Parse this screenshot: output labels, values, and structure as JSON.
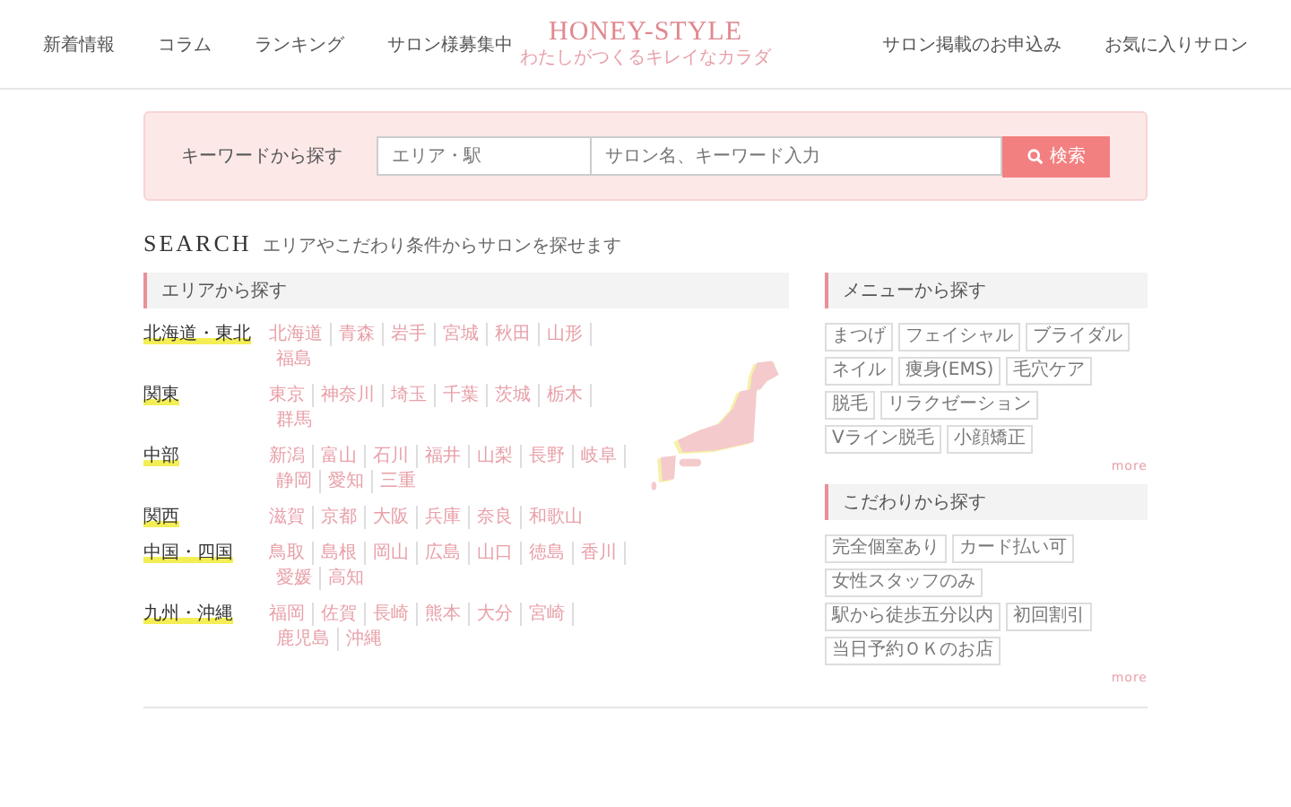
{
  "nav_left": [
    "新着情報",
    "コラム",
    "ランキング",
    "サロン様募集中"
  ],
  "logo": {
    "title": "HONEY-STYLE",
    "tagline": "わたしがつくるキレイなカラダ"
  },
  "nav_right": [
    "サロン掲載のお申込み",
    "お気に入りサロン"
  ],
  "search_box": {
    "label": "キーワードから探す",
    "area": {
      "placeholder": "エリア・駅"
    },
    "keyword": {
      "placeholder": "サロン名、キーワード入力"
    },
    "button": "検索"
  },
  "search_heading": {
    "title": "SEARCH",
    "subtitle": "エリアやこだわり条件からサロンを探せます"
  },
  "area_panel": {
    "title": "エリアから探す",
    "regions": [
      {
        "name": "北海道・東北",
        "prefectures": [
          "北海道",
          "青森",
          "岩手",
          "宮城",
          "秋田",
          "山形",
          "福島"
        ]
      },
      {
        "name": "関東",
        "prefectures": [
          "東京",
          "神奈川",
          "埼玉",
          "千葉",
          "茨城",
          "栃木",
          "群馬"
        ]
      },
      {
        "name": "中部",
        "prefectures": [
          "新潟",
          "富山",
          "石川",
          "福井",
          "山梨",
          "長野",
          "岐阜",
          "静岡",
          "愛知",
          "三重"
        ]
      },
      {
        "name": "関西",
        "prefectures": [
          "滋賀",
          "京都",
          "大阪",
          "兵庫",
          "奈良",
          "和歌山"
        ]
      },
      {
        "name": "中国・四国",
        "prefectures": [
          "鳥取",
          "島根",
          "岡山",
          "広島",
          "山口",
          "徳島",
          "香川",
          "愛媛",
          "高知"
        ]
      },
      {
        "name": "九州・沖縄",
        "prefectures": [
          "福岡",
          "佐賀",
          "長崎",
          "熊本",
          "大分",
          "宮崎",
          "鹿児島",
          "沖縄"
        ]
      }
    ]
  },
  "tag_panels": [
    {
      "title": "メニューから探す",
      "tags": [
        "まつげ",
        "フェイシャル",
        "ブライダル",
        "ネイル",
        "痩身(EMS)",
        "毛穴ケア",
        "脱毛",
        "リラクゼーション",
        "Vライン脱毛",
        "小顔矯正"
      ],
      "more": "more"
    },
    {
      "title": "こだわりから探す",
      "tags": [
        "完全個室あり",
        "カード払い可",
        "女性スタッフのみ",
        "駅から徒歩五分以内",
        "初回割引",
        "当日予約ＯＫのお店"
      ],
      "more": "more"
    }
  ]
}
